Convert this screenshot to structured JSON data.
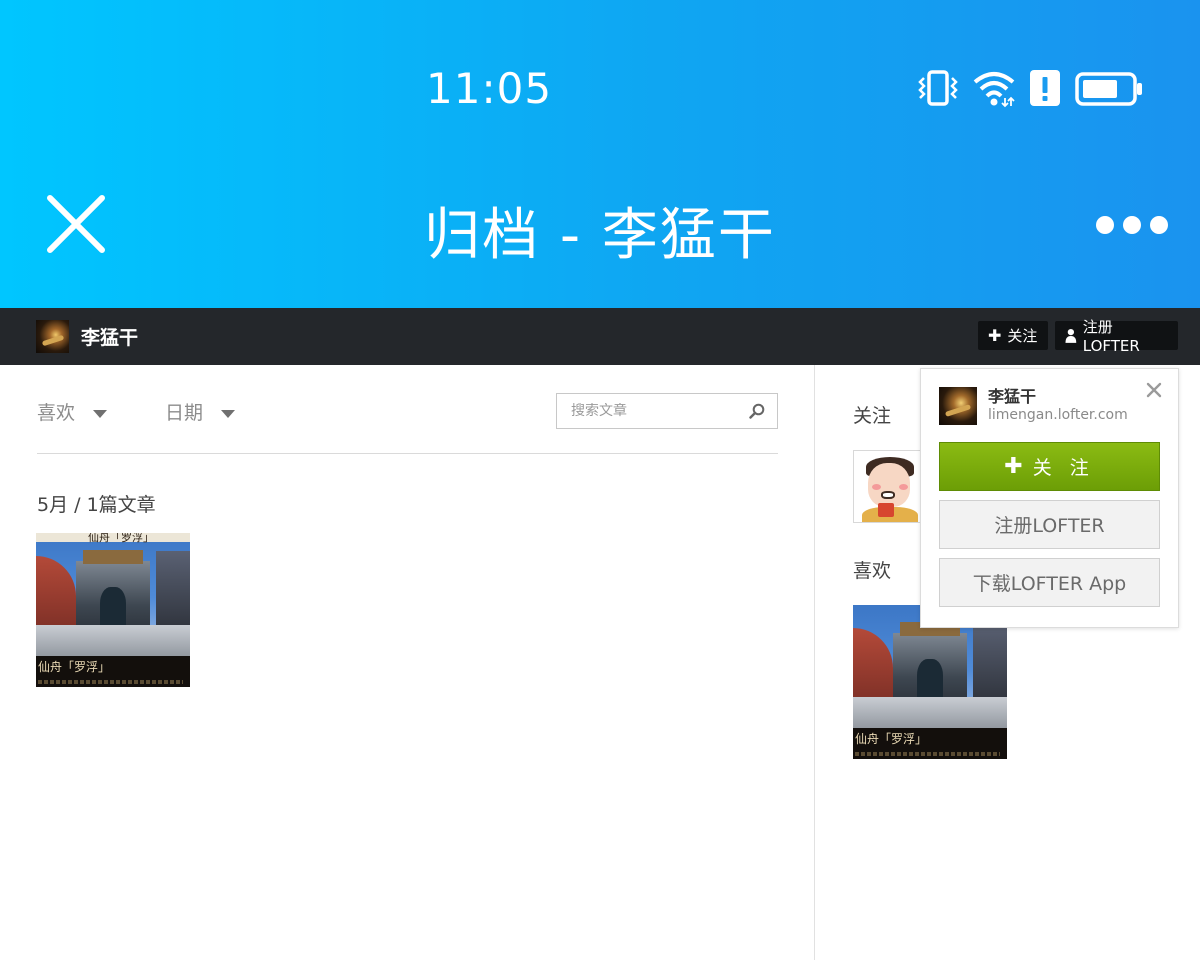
{
  "status_bar": {
    "time": "11:05"
  },
  "app_bar": {
    "title": "归档 - 李猛干"
  },
  "lofter_bar": {
    "blog_name": "李猛干",
    "follow_label": "关注",
    "register_label": "注册LOFTER"
  },
  "filters": {
    "likes_label": "喜欢",
    "date_label": "日期"
  },
  "search": {
    "placeholder": "搜索文章"
  },
  "archive": {
    "month_heading": "5月 / 1篇文章",
    "posts": [
      {
        "caption": "仙舟「罗浮」",
        "top_caption": "仙舟「罗浮」"
      }
    ]
  },
  "sidebar": {
    "follow_heading": "关注",
    "likes_heading": "喜欢",
    "liked_post_caption": "仙舟「罗浮」"
  },
  "popup": {
    "name": "李猛干",
    "domain": "limengan.lofter.com",
    "follow_button": "关 注",
    "register_button": "注册LOFTER",
    "download_button": "下载LOFTER App"
  },
  "colors": {
    "header_start": "#00c6ff",
    "header_end": "#1a93ef",
    "lofter_bar": "#24272b",
    "follow_green": "#7aac0b"
  }
}
